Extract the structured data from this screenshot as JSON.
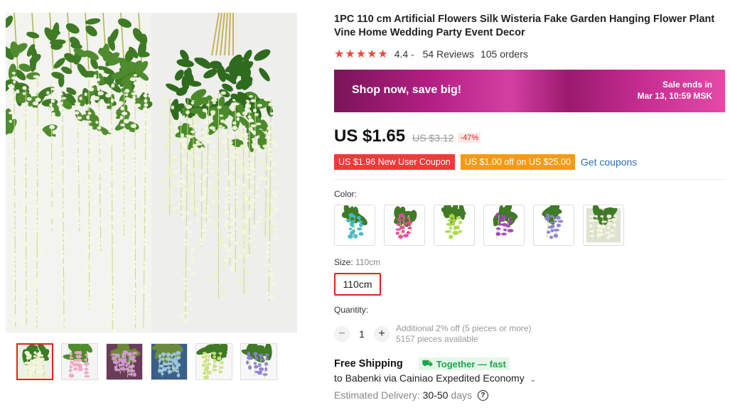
{
  "product": {
    "title": "1PC 110 cm Artificial Flowers Silk Wisteria Fake Garden Hanging Flower Plant Vine Home Wedding Party Event Decor",
    "stars": "★★★★★",
    "rating": "4.4",
    "rating_value": 4.4,
    "reviews": "54 Reviews",
    "orders": "105 orders"
  },
  "banner": {
    "headline": "Shop now, save big!",
    "sale_line1": "Sale ends in",
    "sale_line2": "Mar 13, 10:59 MSK"
  },
  "pricing": {
    "price": "US $1.65",
    "old_price": "US $3.12",
    "discount": "-47%"
  },
  "coupons": {
    "new_user": "US $1.96 New User Coupon",
    "store": "US $1.00 off on US $25.00",
    "get_coupons": "Get coupons"
  },
  "color": {
    "label": "Color:",
    "options": [
      "blue",
      "pink",
      "green",
      "purple",
      "lavender",
      "white"
    ],
    "colors": [
      "#3fb8c9",
      "#e8479b",
      "#a9d83a",
      "#a23fbf",
      "#8b7dd6",
      "#e7ecd8"
    ]
  },
  "size": {
    "label": "Size:",
    "value": "110cm",
    "option": "110cm"
  },
  "quantity": {
    "label": "Quantity:",
    "minus": "−",
    "value": "1",
    "plus": "+",
    "note1": "Additional 2% off (5 pieces or more)",
    "note2": "5157 pieces available"
  },
  "shipping": {
    "title": "Free Shipping",
    "tag": "Together — fast",
    "destination": "to Babenki via Cainiao Expedited Economy",
    "delivery_label": "Estimated Delivery:",
    "delivery_value": "30-50",
    "delivery_unit": "days",
    "help": "?"
  },
  "theme": {
    "accent_red": "#e2231a",
    "link_blue": "#2a6fb7",
    "green": "#1fa34a"
  }
}
